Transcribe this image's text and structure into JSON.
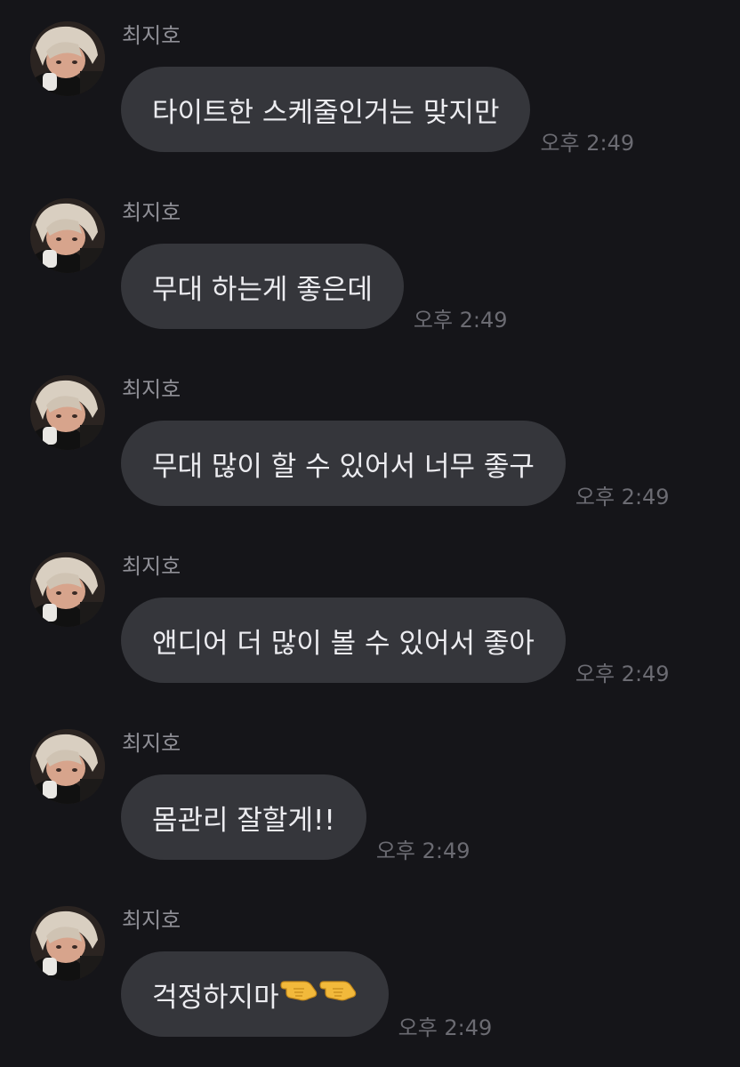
{
  "conversation": {
    "messages": [
      {
        "sender": "최지호",
        "text": "타이트한 스케줄인거는 맞지만",
        "time": "오후 2:49"
      },
      {
        "sender": "최지호",
        "text": "무대 하는게 좋은데",
        "time": "오후 2:49"
      },
      {
        "sender": "최지호",
        "text": "무대 많이 할 수 있어서 너무 좋구",
        "time": "오후 2:49"
      },
      {
        "sender": "최지호",
        "text": "앤디어 더 많이 볼 수 있어서 좋아",
        "time": "오후 2:49"
      },
      {
        "sender": "최지호",
        "text": "몸관리 잘할게!!",
        "time": "오후 2:49"
      },
      {
        "sender": "최지호",
        "text": "걱정하지마",
        "emojis": [
          "pointing-hand-emoji",
          "pointing-hand-emoji"
        ],
        "time": "오후 2:49"
      }
    ]
  },
  "colors": {
    "background": "#151519",
    "bubble": "#35363b",
    "message_text": "#ececf0",
    "name_text": "#8f8f96",
    "time_text": "#6b6b72"
  }
}
